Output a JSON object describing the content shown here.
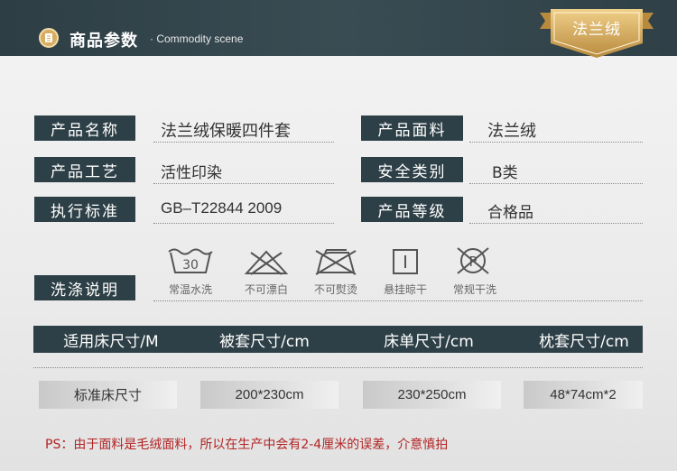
{
  "header": {
    "title": "商品参数",
    "subtitle": "· Commodity scene",
    "badge": "法兰绒"
  },
  "params": [
    {
      "label": "产品名称",
      "value": "法兰绒保暖四件套"
    },
    {
      "label": "产品面料",
      "value": "法兰绒"
    },
    {
      "label": "产品工艺",
      "value": "活性印染"
    },
    {
      "label": "安全类别",
      "value": "B类"
    },
    {
      "label": "执行标准",
      "value": "GB–T22844 2009"
    },
    {
      "label": "产品等级",
      "value": "合格品"
    }
  ],
  "care": {
    "label": "洗涤说明",
    "items": [
      {
        "icon": "wash-30-icon",
        "text": "常温水洗",
        "number": "30"
      },
      {
        "icon": "no-bleach-icon",
        "text": "不可漂白"
      },
      {
        "icon": "no-iron-icon",
        "text": "不可熨烫"
      },
      {
        "icon": "hang-dry-icon",
        "text": "悬挂晾干"
      },
      {
        "icon": "dry-clean-icon",
        "text": "常规干洗",
        "letter": "P"
      }
    ]
  },
  "sizes": {
    "headers": [
      "适用床尺寸/M",
      "被套尺寸/cm",
      "床单尺寸/cm",
      "枕套尺寸/cm"
    ],
    "values": [
      "标准床尺寸",
      "200*230cm",
      "230*250cm",
      "48*74cm*2"
    ]
  },
  "note": "PS：由于面料是毛绒面料，所以在生产中会有2-4厘米的误差，介意慎拍",
  "colors": {
    "dark": "#2e4047",
    "gold": "#d6ad63",
    "note": "#b32424"
  }
}
